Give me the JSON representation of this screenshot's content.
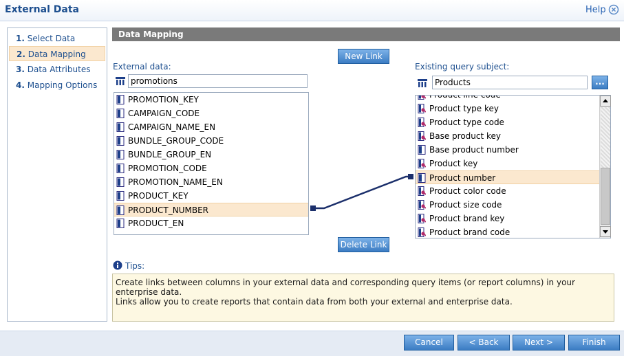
{
  "window": {
    "title": "External Data",
    "help": "Help",
    "close_icon": "close-circle-icon"
  },
  "steps": [
    {
      "num": "1.",
      "label": "Select Data"
    },
    {
      "num": "2.",
      "label": "Data Mapping",
      "active": true
    },
    {
      "num": "3.",
      "label": "Data Attributes"
    },
    {
      "num": "4.",
      "label": "Mapping Options"
    }
  ],
  "section": {
    "title": "Data Mapping"
  },
  "buttons": {
    "new_link": "New Link",
    "delete_link": "Delete Link",
    "browse": "..."
  },
  "external": {
    "label": "External data:",
    "source": "promotions",
    "items": [
      "PROMOTION_KEY",
      "CAMPAIGN_CODE",
      "CAMPAIGN_NAME_EN",
      "BUNDLE_GROUP_CODE",
      "BUNDLE_GROUP_EN",
      "PROMOTION_CODE",
      "PROMOTION_NAME_EN",
      "PRODUCT_KEY",
      "PRODUCT_NUMBER",
      "PRODUCT_EN"
    ],
    "selected": "PRODUCT_NUMBER"
  },
  "existing": {
    "label": "Existing query subject:",
    "subject": "Products",
    "items": [
      "Product line code",
      "Product type key",
      "Product type code",
      "Base product key",
      "Base product number",
      "Product key",
      "Product number",
      "Product color code",
      "Product size code",
      "Product brand key",
      "Product brand code"
    ],
    "selected": "Product number"
  },
  "tips": {
    "label": "Tips:",
    "text": "Create links between columns in your external data and corresponding query items (or report columns) in your enterprise data.\nLinks allow you to create reports that contain data from both your external and enterprise data."
  },
  "footer": {
    "cancel": "Cancel",
    "back": "< Back",
    "next": "Next >",
    "finish": "Finish"
  },
  "colors": {
    "accent": "#1d4f8f",
    "selection": "#fbe8cf",
    "link_line": "#1b2f6b",
    "header": "#7a7a7a",
    "button": "#3b7cc3"
  }
}
